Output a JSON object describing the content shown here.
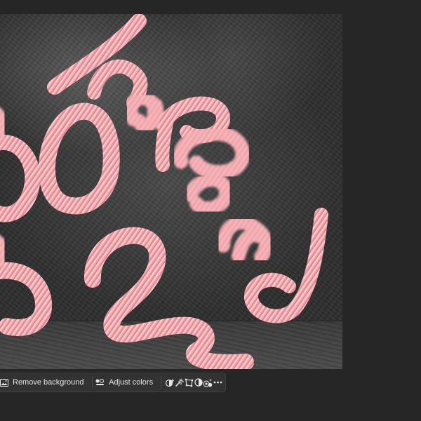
{
  "toolbar": {
    "remove_background_label": "Remove background",
    "adjust_colors_label": "Adjust colors"
  },
  "icons": {
    "remove_background": "image-icon",
    "adjust_colors": "adjust-colors-icon",
    "mask": "mask-icon",
    "magic_select": "magic-wand-icon",
    "transform": "crop-transform-icon",
    "contrast": "contrast-circle-icon",
    "effects": "effects-icon",
    "more": "more-horizontal-icon"
  },
  "colors": {
    "workspace_bg": "#262626",
    "toolbar_bg": "#323232",
    "toolbar_text": "#e6e6e6",
    "art_pink": "#f2a2a6"
  }
}
